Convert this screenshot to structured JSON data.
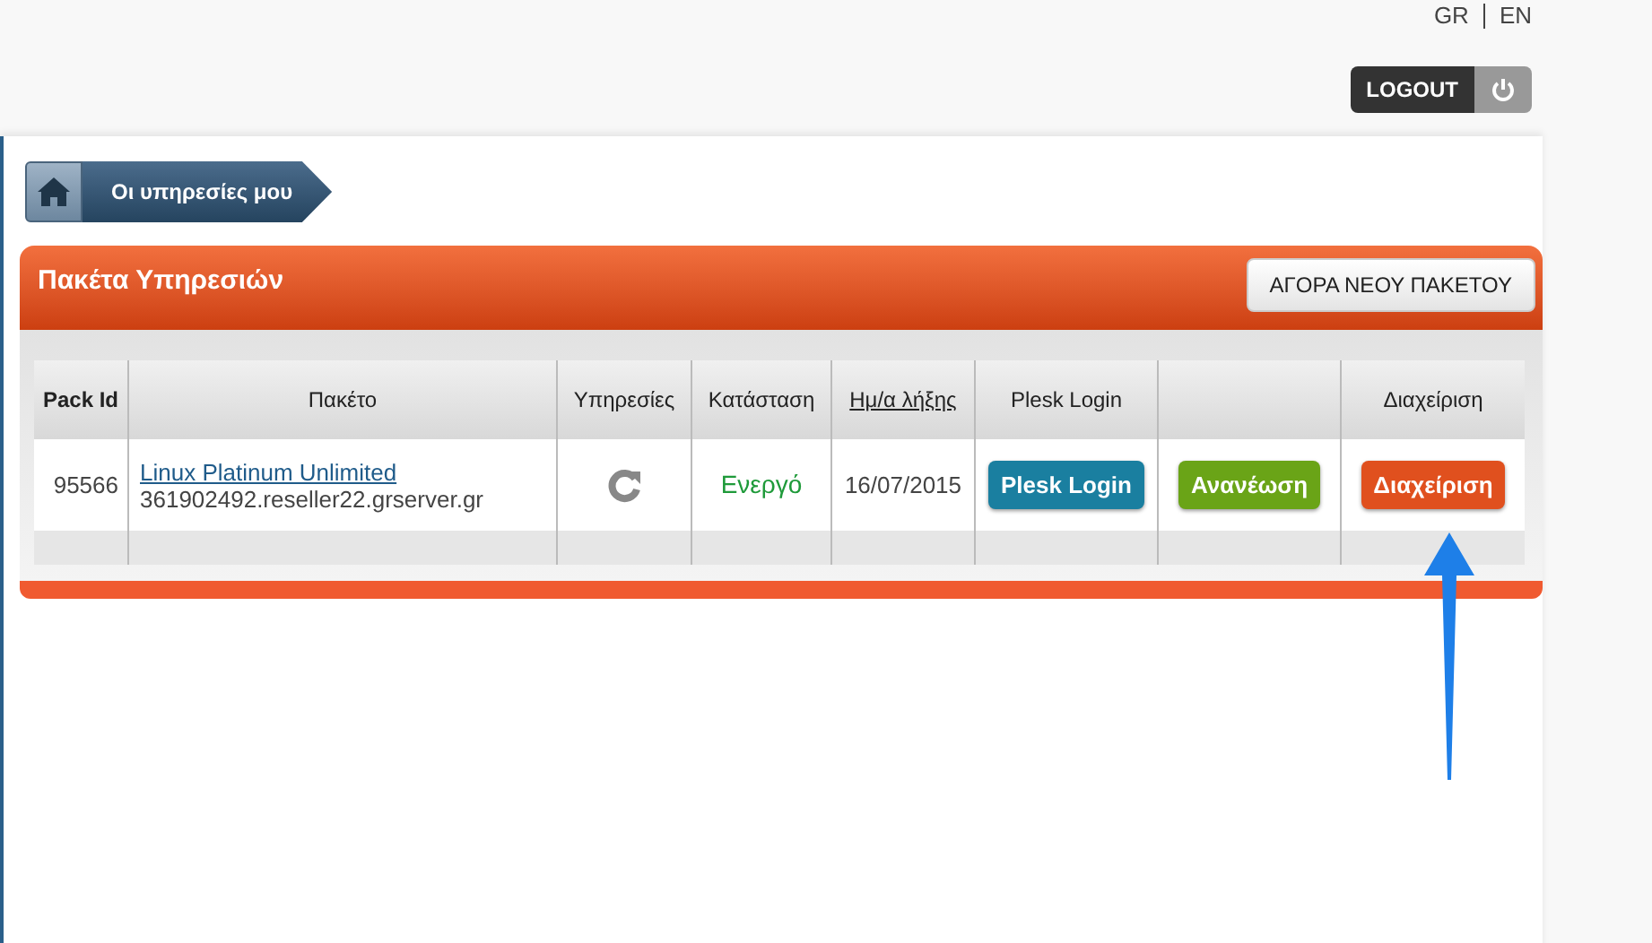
{
  "languages": [
    {
      "label": "GR"
    },
    {
      "label": "EN"
    }
  ],
  "logout": {
    "label": "LOGOUT"
  },
  "breadcrumb": {
    "items": [
      "Οι υπηρεσίες μου"
    ]
  },
  "panel": {
    "title": "Πακέτα Υπηρεσιών",
    "action": "ΑΓΟΡΑ ΝΕΟΥ ΠΑΚΕΤΟΥ"
  },
  "table": {
    "columns": [
      {
        "label": "Pack Id",
        "kind": "text"
      },
      {
        "label": "Πακέτο",
        "kind": "text"
      },
      {
        "label": "Υπηρεσίες",
        "kind": "text"
      },
      {
        "label": "Κατάσταση",
        "kind": "text"
      },
      {
        "label": "Ημ/α λήξης",
        "kind": "link"
      },
      {
        "label": "Plesk Login",
        "kind": "text"
      },
      {
        "kind": "empty"
      },
      {
        "label": "Διαχείριση",
        "kind": "text"
      }
    ],
    "rows": [
      {
        "pack_id": "95566",
        "package_name": "Linux Platinum Unlimited",
        "package_host": "361902492.reseller22.grserver.gr",
        "status": "Ενεργό",
        "expiry": "16/07/2015",
        "buttons": [
          {
            "label": "Plesk Login",
            "color": "#1a7fa0"
          },
          {
            "label": "Ανανέωση",
            "color": "#6aa417"
          },
          {
            "label": "Διαχείριση",
            "color": "#e0501e"
          }
        ]
      }
    ]
  }
}
